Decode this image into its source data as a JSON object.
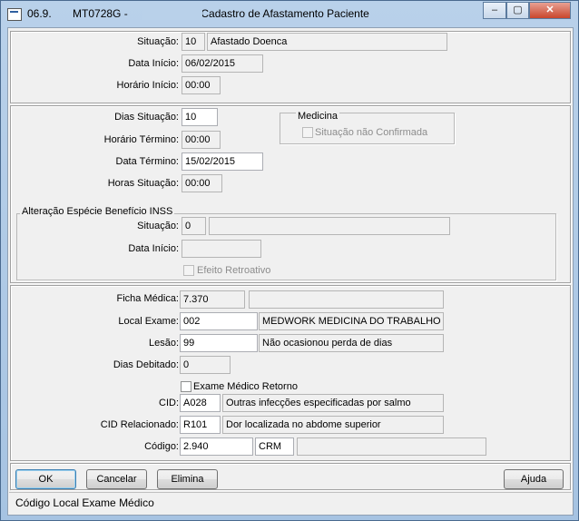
{
  "window": {
    "title": "06.9.       MT0728G -                      - Cadastro de Afastamento Paciente",
    "minimize": "–",
    "maximize": "▢",
    "close": "✕"
  },
  "section1": {
    "situacao_label": "Situação:",
    "situacao_code": "10",
    "situacao_desc": "Afastado Doenca",
    "data_inicio_label": "Data Início:",
    "data_inicio": "06/02/2015",
    "horario_inicio_label": "Horário Início:",
    "horario_inicio": "00:00"
  },
  "section2": {
    "dias_situacao_label": "Dias Situação:",
    "dias_situacao": "10",
    "horario_termino_label": "Horário Término:",
    "horario_termino": "00:00",
    "data_termino_label": "Data Término:",
    "data_termino": "15/02/2015",
    "horas_situacao_label": "Horas Situação:",
    "horas_situacao": "00:00",
    "medicina_title": "Medicina",
    "situacao_nao_confirmada": "Situação não Confirmada",
    "inss_title": "Alteração Espécie Benefício INSS",
    "inss_situacao_label": "Situação:",
    "inss_situacao_code": "0",
    "inss_situacao_desc": "",
    "inss_data_inicio_label": "Data Início:",
    "inss_data_inicio": "",
    "efeito_retroativo": "Efeito Retroativo"
  },
  "section3": {
    "ficha_medica_label": "Ficha Médica:",
    "ficha_medica": "7.370",
    "ficha_medica_desc": "",
    "local_exame_label": "Local Exame:",
    "local_exame": "002",
    "local_exame_desc": "MEDWORK MEDICINA DO TRABALHO",
    "lesao_label": "Lesão:",
    "lesao": "99",
    "lesao_desc": "Não ocasionou perda de dias",
    "dias_debitado_label": "Dias Debitado:",
    "dias_debitado": "0",
    "exame_medico_retorno": "Exame Médico Retorno",
    "cid_label": "CID:",
    "cid": "A028",
    "cid_desc": "Outras infecções especificadas por salmo",
    "cid_rel_label": "CID Relacionado:",
    "cid_rel": "R101",
    "cid_rel_desc": "Dor localizada no abdome superior",
    "codigo_label": "Código:",
    "codigo": "2.940",
    "crm": "CRM",
    "crm_desc": ""
  },
  "buttons": {
    "ok": "OK",
    "cancelar": "Cancelar",
    "elimina": "Elimina",
    "ajuda": "Ajuda"
  },
  "status_bar": "Código Local Exame Médico"
}
